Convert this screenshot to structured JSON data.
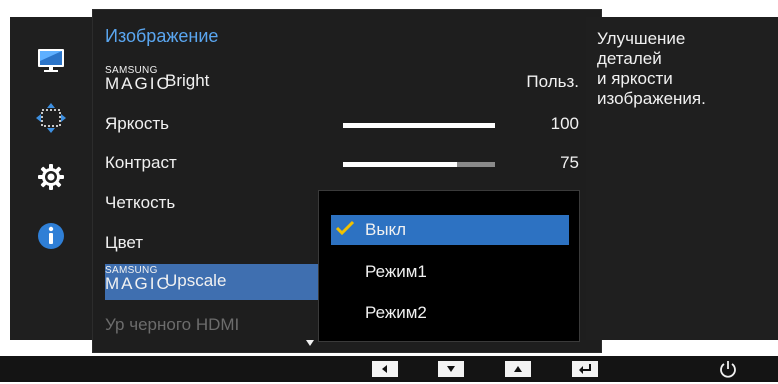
{
  "menu": {
    "title": "Изображение",
    "magic_bright": {
      "brand": "SAMSUNG",
      "magic": "MAGIC",
      "word": "Bright",
      "value": "Польз."
    },
    "brightness": {
      "label": "Яркость",
      "value": "100",
      "level": 100
    },
    "contrast": {
      "label": "Контраст",
      "value": "75",
      "level": 75
    },
    "sharpness": {
      "label": "Четкость"
    },
    "color": {
      "label": "Цвет"
    },
    "magic_upscale": {
      "brand": "SAMSUNG",
      "magic": "MAGIC",
      "word": "Upscale"
    },
    "hdmi_black": {
      "label": "Ур черного HDMI"
    }
  },
  "dropdown": {
    "options": [
      {
        "label": "Выкл",
        "selected": true
      },
      {
        "label": "Режим1"
      },
      {
        "label": "Режим2"
      }
    ]
  },
  "info": {
    "lines": [
      "Улучшение",
      "деталей",
      "и яркости",
      "изображения."
    ]
  },
  "sidebar_icons": [
    "picture-icon",
    "position-icon",
    "settings-gear-icon",
    "info-icon"
  ],
  "colors": {
    "accent_text": "#5aa6f0",
    "selected_row": "#3f6fb0",
    "dropdown_selected": "#2d72c2",
    "check": "#f2c200"
  }
}
